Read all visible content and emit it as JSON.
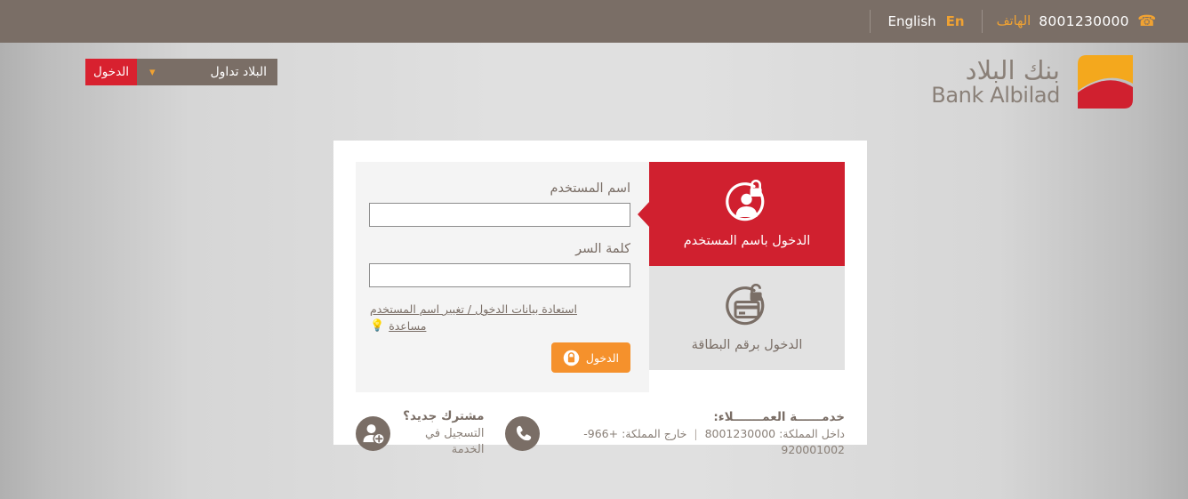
{
  "topbar": {
    "phone_label": "الهاتف",
    "phone_number": "8001230000",
    "phone_icon": "phone-icon",
    "lang_english": "English",
    "lang_abbr": "En"
  },
  "nav": {
    "login_button": "الدخول",
    "dropdown_label": "البلاد تداول",
    "chevron": "chevron-down-icon"
  },
  "logo": {
    "arabic": "بنك البلاد",
    "english": "Bank Albilad",
    "emblem_orange": "#f4a81d",
    "emblem_red": "#d0202f"
  },
  "tabs": [
    {
      "label": "الدخول باسم المستخدم",
      "icon": "user-lock-icon",
      "active": true
    },
    {
      "label": "الدخول برقم البطاقة",
      "icon": "card-lock-icon",
      "active": false
    }
  ],
  "form": {
    "username_label": "اسم المستخدم",
    "username_value": "",
    "username_placeholder": "",
    "password_label": "كلمة السر",
    "password_value": "",
    "password_placeholder": "",
    "recover_link": "استعادة بيانات الدخول / تغيير اسم المستخدم",
    "help_link": "مساعدة",
    "help_icon": "lightbulb-icon",
    "submit_label": "الدخول",
    "submit_icon": "lock-icon"
  },
  "footer": {
    "new_subscriber_title": "مشترك جديد؟",
    "new_subscriber_sub": "التسجيل في الخدمة",
    "new_subscriber_icon": "add-user-icon",
    "support_title": "خدمــــــة العمـــــــلاء:",
    "support_icon": "phone-icon",
    "support_inside_label": "داخل المملكة:",
    "support_inside_number": "8001230000",
    "support_separator": "|",
    "support_outside_label": "خارج المملكة:",
    "support_outside_number": "+966-920001002"
  },
  "colors": {
    "brand_red": "#d0202f",
    "brand_orange": "#f5912c",
    "brand_brown": "#7a6e66"
  }
}
